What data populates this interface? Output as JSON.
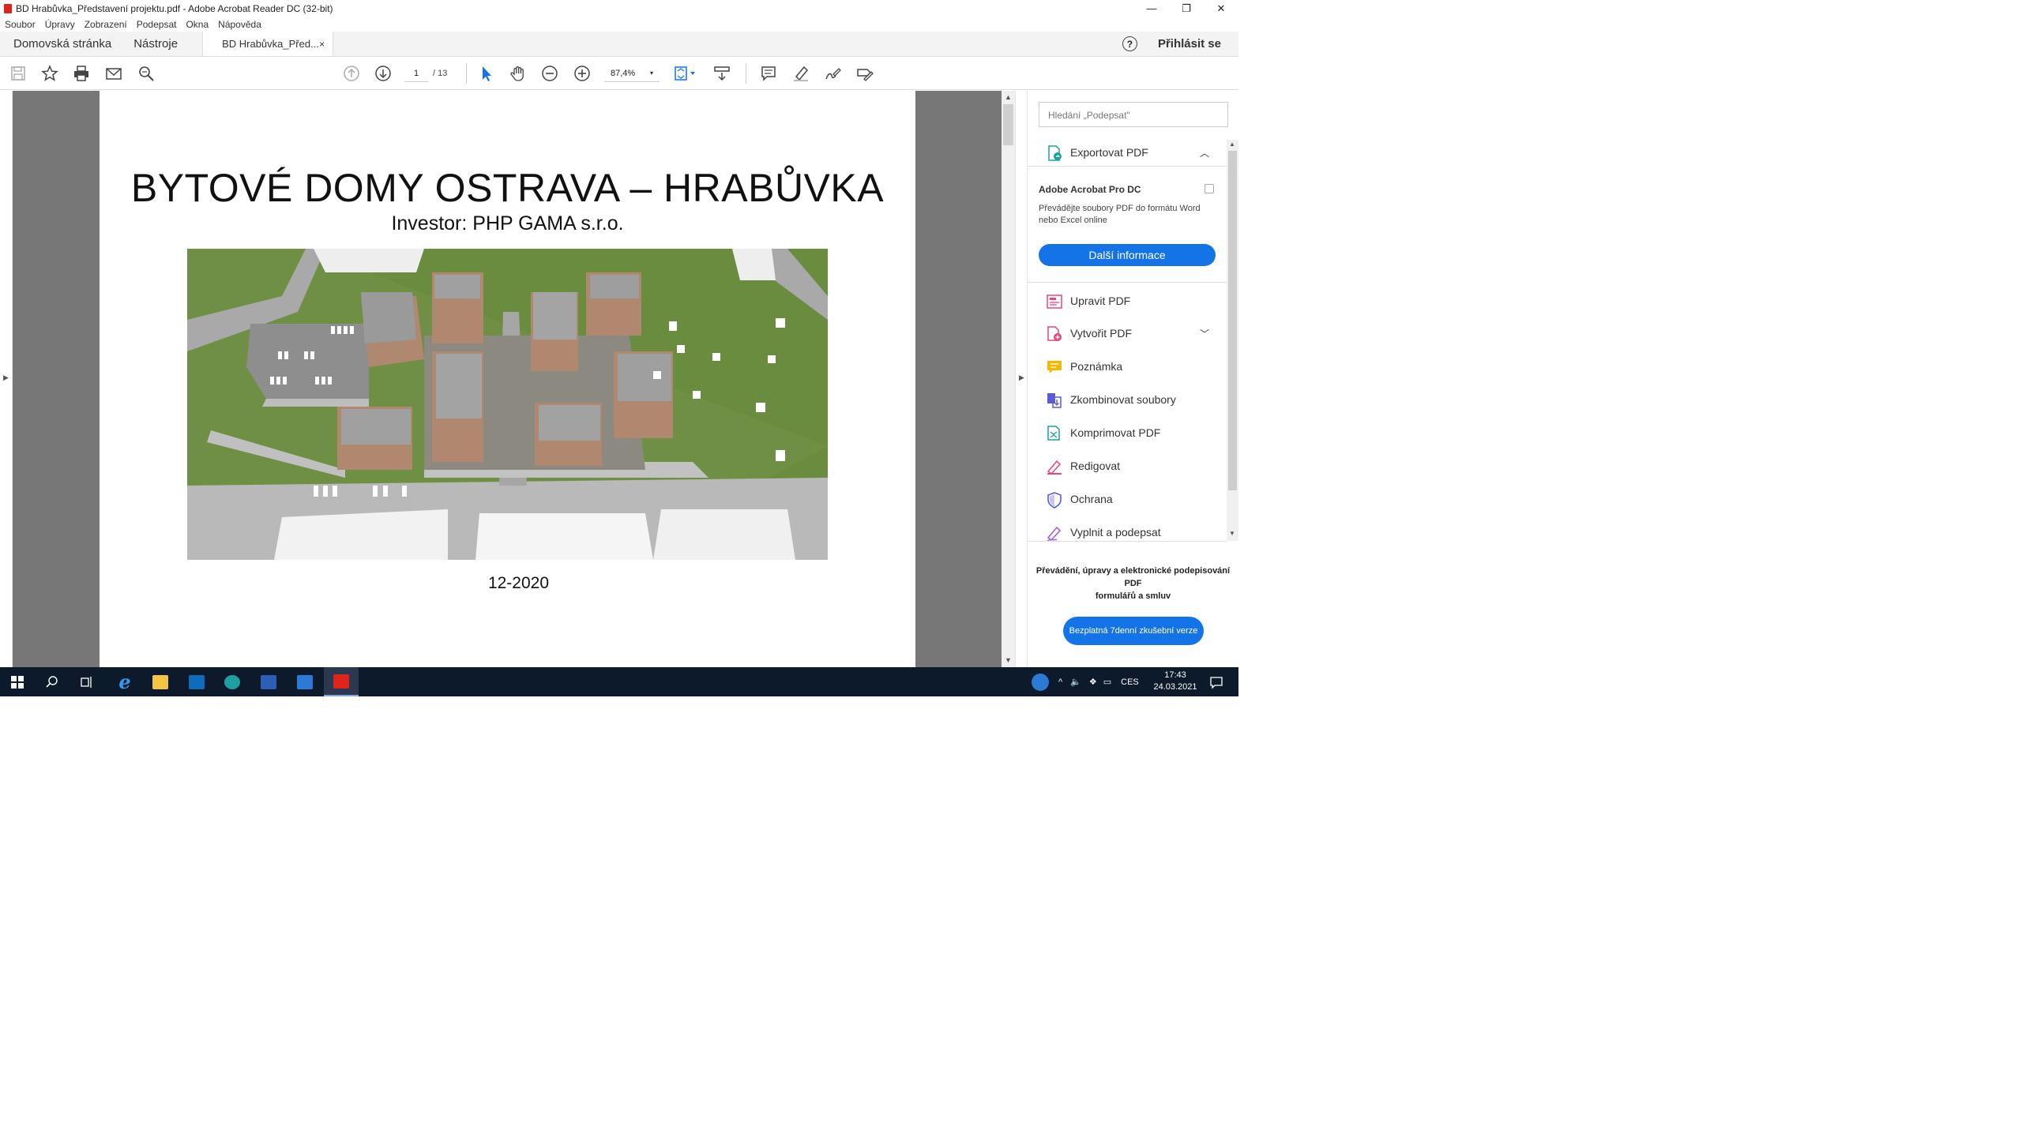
{
  "window": {
    "title": "BD Hrabůvka_Představení projektu.pdf - Adobe Acrobat Reader DC (32-bit)",
    "minimize": "—",
    "restore": "❐",
    "close": "✕"
  },
  "menu": [
    "Soubor",
    "Úpravy",
    "Zobrazení",
    "Podepsat",
    "Okna",
    "Nápověda"
  ],
  "tabs": {
    "home": "Domovská stránka",
    "tools": "Nástroje",
    "document": "BD Hrabůvka_Před...",
    "close": "×",
    "help": "?",
    "signin": "Přihlásit se"
  },
  "toolbar": {
    "page_current": "1",
    "page_total": "/ 13",
    "zoom": "87,4%",
    "zoom_caret": "▾"
  },
  "document": {
    "title": "BYTOVÉ DOMY OSTRAVA – HRABŮVKA",
    "subtitle": "Investor: PHP GAMA s.r.o.",
    "date": "12-2020"
  },
  "sidepane": {
    "search_placeholder": "Hledání „Podepsat\"",
    "export_label": "Exportovat PDF",
    "promo_title": "Adobe Acrobat Pro DC",
    "promo_text": "Převádějte soubory PDF do formátu Word nebo Excel online",
    "promo_button": "Další informace",
    "tools": [
      {
        "label": "Upravit PDF",
        "icon": "edit-pdf-icon",
        "color": "#e8467c"
      },
      {
        "label": "Vytvořit PDF",
        "icon": "create-pdf-icon",
        "color": "#e8467c"
      },
      {
        "label": "Poznámka",
        "icon": "comment-icon",
        "color": "#f5b800"
      },
      {
        "label": "Zkombinovat soubory",
        "icon": "combine-icon",
        "color": "#5b5bd6"
      },
      {
        "label": "Komprimovat PDF",
        "icon": "compress-icon",
        "color": "#1ba29b"
      },
      {
        "label": "Redigovat",
        "icon": "redact-icon",
        "color": "#e8467c"
      },
      {
        "label": "Ochrana",
        "icon": "protect-icon",
        "color": "#5b5bd6"
      },
      {
        "label": "Vyplnit a podepsat",
        "icon": "fill-sign-icon",
        "color": "#9b5bd6"
      }
    ],
    "bottom_text_1": "Převádění, úpravy a elektronické podepisování PDF",
    "bottom_text_2": "formulářů a smluv",
    "trial_button": "Bezplatná 7denní zkušební verze"
  },
  "taskbar": {
    "lang": "CES",
    "time": "17:43",
    "date": "24.03.2021"
  },
  "colors": {
    "accent": "#1473e6",
    "taskbar": "#0d1a2b",
    "acrobat_red": "#e0241b"
  }
}
